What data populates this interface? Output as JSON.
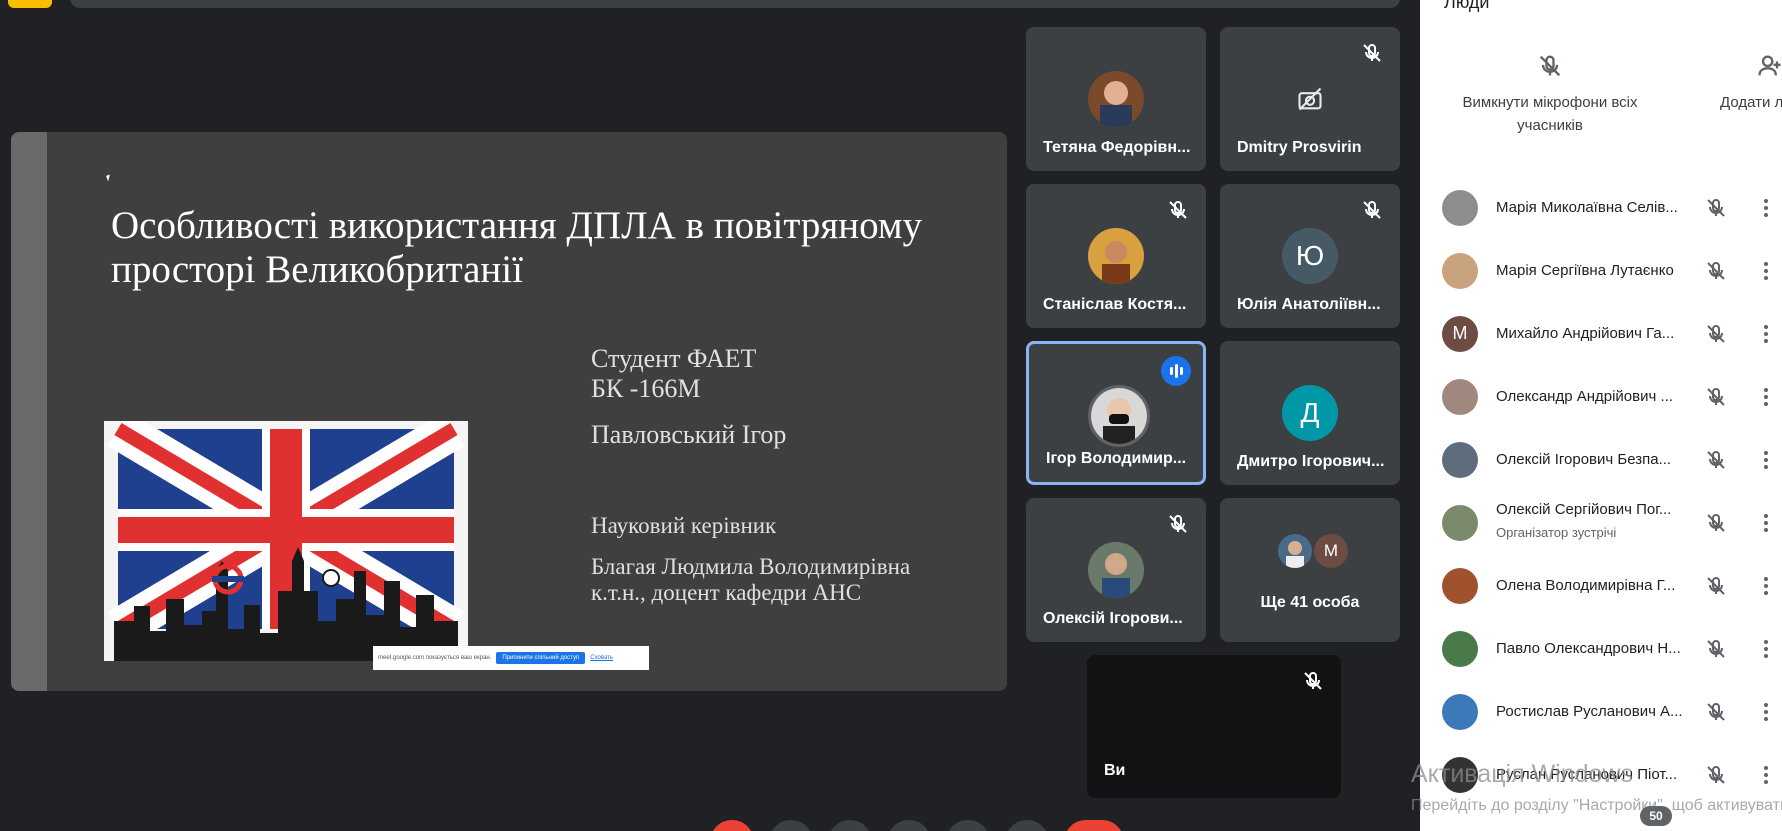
{
  "slide": {
    "title": "Особливості використання ДПЛА в повітряному просторі Великобританії",
    "student_line1": "Студент ФАЕТ",
    "student_line2": "БК -166М",
    "student_name": "Павловський Ігор",
    "supervisor_label": "Науковий керівник",
    "supervisor_name": "Благая Людмила Володимирівна",
    "supervisor_title": "к.т.н., доцент кафедри АНС",
    "share_notice": "meet.google.com показується ваш екран.",
    "share_stop": "Припинити спільний доступ",
    "share_hide": "Сховать"
  },
  "tiles": [
    {
      "name": "Тетяна Федорівн...",
      "muted": false,
      "avatar": "photo"
    },
    {
      "name": "Dmitry Prosvirin",
      "muted": true,
      "avatar": "camera-off-icon"
    },
    {
      "name": "Станіслав Костя...",
      "muted": true,
      "avatar": "photo"
    },
    {
      "name": "Юлія Анатоліївн...",
      "muted": true,
      "avatar_letter": "Ю",
      "color": "#455a64"
    },
    {
      "name": "Ігор Володимир...",
      "muted": false,
      "speaking": true,
      "avatar": "photo"
    },
    {
      "name": "Дмитро Ігорович...",
      "muted": false,
      "avatar_letter": "Д",
      "color": "#0097a7"
    },
    {
      "name": "Олексій Ігорови...",
      "muted": true,
      "avatar": "photo"
    },
    {
      "name": "Ще 41 особа",
      "avatar_letter": "M",
      "color": "#6d4c41"
    }
  ],
  "self_tile": {
    "name": "Ви"
  },
  "panel": {
    "title": "Люди",
    "mute_all": "Вимкнути мікрофони всіх учасників",
    "add_people": "Додати людей",
    "participants": [
      {
        "name": "Марія Миколаївна Селів...",
        "avatar_color": "#8d8d8d"
      },
      {
        "name": "Марія Сергіївна Лутаєнко",
        "avatar_color": "#c9a27e"
      },
      {
        "name": "Михайло Андрійович Га...",
        "avatar_letter": "М",
        "avatar_color": "#6d4c41"
      },
      {
        "name": "Олександр Андрійович ...",
        "avatar_color": "#a1887f"
      },
      {
        "name": "Олексій Ігорович Безпа...",
        "avatar_color": "#5d6d7e"
      },
      {
        "name": "Олексій Сергійович Пог...",
        "role": "Організатор зустрічі",
        "avatar_color": "#7b8a6a"
      },
      {
        "name": "Олена Володимирівна Г...",
        "avatar_color": "#a0522d"
      },
      {
        "name": "Павло Олександрович Н...",
        "avatar_color": "#4a7a4a"
      },
      {
        "name": "Ростислав Русланович А...",
        "avatar_color": "#3b79b8"
      },
      {
        "name": "Руслан Русланович Піот...",
        "avatar_color": "#333333"
      }
    ]
  },
  "os": {
    "activation_title": "Активація Windows",
    "activation_text": "Перейдіть до розділу \"Настройки\", щоб активувати Windows.",
    "count_badge": "50"
  }
}
